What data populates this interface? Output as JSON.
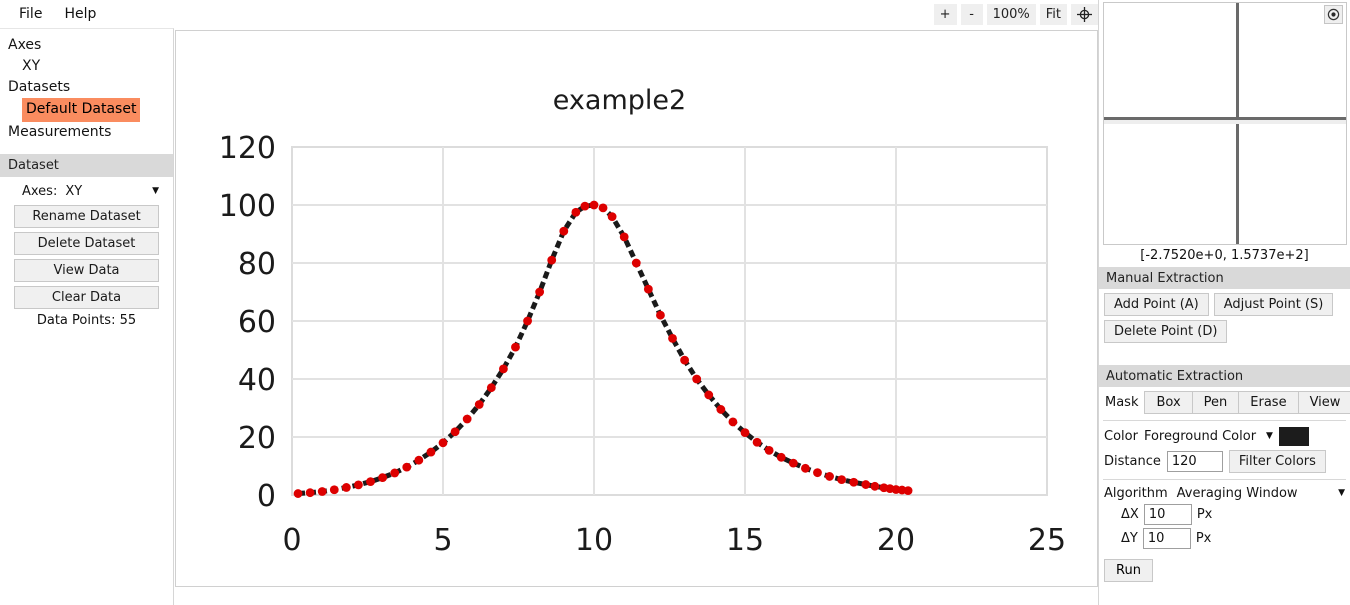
{
  "menu": {
    "items": [
      {
        "label": "File"
      },
      {
        "label": "Help"
      }
    ]
  },
  "zoom_toolbar": {
    "zoom_in_label": "+",
    "zoom_out_label": "-",
    "zoom_level_label": "100%",
    "fit_label": "Fit",
    "crosshair_icon": "crosshair-target-icon"
  },
  "sidebar": {
    "tree": [
      {
        "label": "Axes",
        "indent": false,
        "selected": false
      },
      {
        "label": "XY",
        "indent": true,
        "selected": false
      },
      {
        "label": "Datasets",
        "indent": false,
        "selected": false
      },
      {
        "label": "Default Dataset",
        "indent": true,
        "selected": true
      },
      {
        "label": "Measurements",
        "indent": false,
        "selected": false
      }
    ],
    "panel": {
      "header": "Dataset",
      "axes_label": "Axes:",
      "axes_value": "XY",
      "buttons": [
        {
          "label": "Rename Dataset"
        },
        {
          "label": "Delete Dataset"
        },
        {
          "label": "View Data"
        },
        {
          "label": "Clear Data"
        }
      ],
      "data_points_text": "Data Points: 55"
    },
    "selection_color": "#fa8c5f"
  },
  "magnifier": {
    "coords_label": "[-2.7520e+0, 1.5737e+2]",
    "gear_icon": "target-settings-icon"
  },
  "manual_extraction": {
    "header": "Manual Extraction",
    "buttons": [
      {
        "label": "Add Point (A)"
      },
      {
        "label": "Adjust Point (S)"
      },
      {
        "label": "Delete Point (D)"
      }
    ]
  },
  "automatic_extraction": {
    "header": "Automatic Extraction",
    "mask_label": "Mask",
    "mask_options": [
      {
        "label": "Box"
      },
      {
        "label": "Pen"
      },
      {
        "label": "Erase"
      },
      {
        "label": "View"
      }
    ],
    "color_label": "Color",
    "color_value": "Foreground Color",
    "color_swatch": "#1c1c1c",
    "distance_label": "Distance",
    "distance_value": "120",
    "filter_colors_label": "Filter Colors",
    "algorithm_label": "Algorithm",
    "algorithm_value": "Averaging Window",
    "delta_x_label": "ΔX",
    "delta_x_value": "10",
    "delta_x_unit": "Px",
    "delta_y_label": "ΔY",
    "delta_y_value": "10",
    "delta_y_unit": "Px",
    "run_label": "Run"
  },
  "chart_data": {
    "type": "scatter",
    "title": "example2",
    "xlabel": "",
    "ylabel": "",
    "xlim": [
      0,
      25
    ],
    "ylim": [
      0,
      120
    ],
    "xticks": [
      0,
      5,
      10,
      15,
      20,
      25
    ],
    "yticks": [
      0,
      20,
      40,
      60,
      80,
      100,
      120
    ],
    "grid": true,
    "legend": "none",
    "curve_color": "#1a1a1a",
    "point_color": "#dd0000",
    "curve_style": "dashed",
    "point_count": 55,
    "series": [
      {
        "name": "Default Dataset",
        "x": [
          0.2,
          0.6,
          1.0,
          1.4,
          1.8,
          2.2,
          2.6,
          3.0,
          3.4,
          3.8,
          4.2,
          4.6,
          5.0,
          5.4,
          5.8,
          6.2,
          6.6,
          7.0,
          7.4,
          7.8,
          8.2,
          8.6,
          9.0,
          9.4,
          9.7,
          10.0,
          10.3,
          10.6,
          11.0,
          11.4,
          11.8,
          12.2,
          12.6,
          13.0,
          13.4,
          13.8,
          14.2,
          14.6,
          15.0,
          15.4,
          15.8,
          16.2,
          16.6,
          17.0,
          17.4,
          17.8,
          18.2,
          18.6,
          19.0,
          19.3,
          19.6,
          19.8,
          20.0,
          20.2,
          20.4
        ],
        "y": [
          0.5,
          0.8,
          1.2,
          1.8,
          2.6,
          3.5,
          4.6,
          6.0,
          7.6,
          9.6,
          12.0,
          14.8,
          18.0,
          21.8,
          26.2,
          31.2,
          37.0,
          43.5,
          51.0,
          60.0,
          70.0,
          81.0,
          91.0,
          97.5,
          99.6,
          100.0,
          99.0,
          96.0,
          89.0,
          80.0,
          71.0,
          62.0,
          54.0,
          46.5,
          40.0,
          34.5,
          29.5,
          25.2,
          21.5,
          18.2,
          15.4,
          13.0,
          11.0,
          9.2,
          7.7,
          6.4,
          5.3,
          4.4,
          3.6,
          3.0,
          2.5,
          2.2,
          1.9,
          1.7,
          1.5
        ]
      }
    ]
  }
}
